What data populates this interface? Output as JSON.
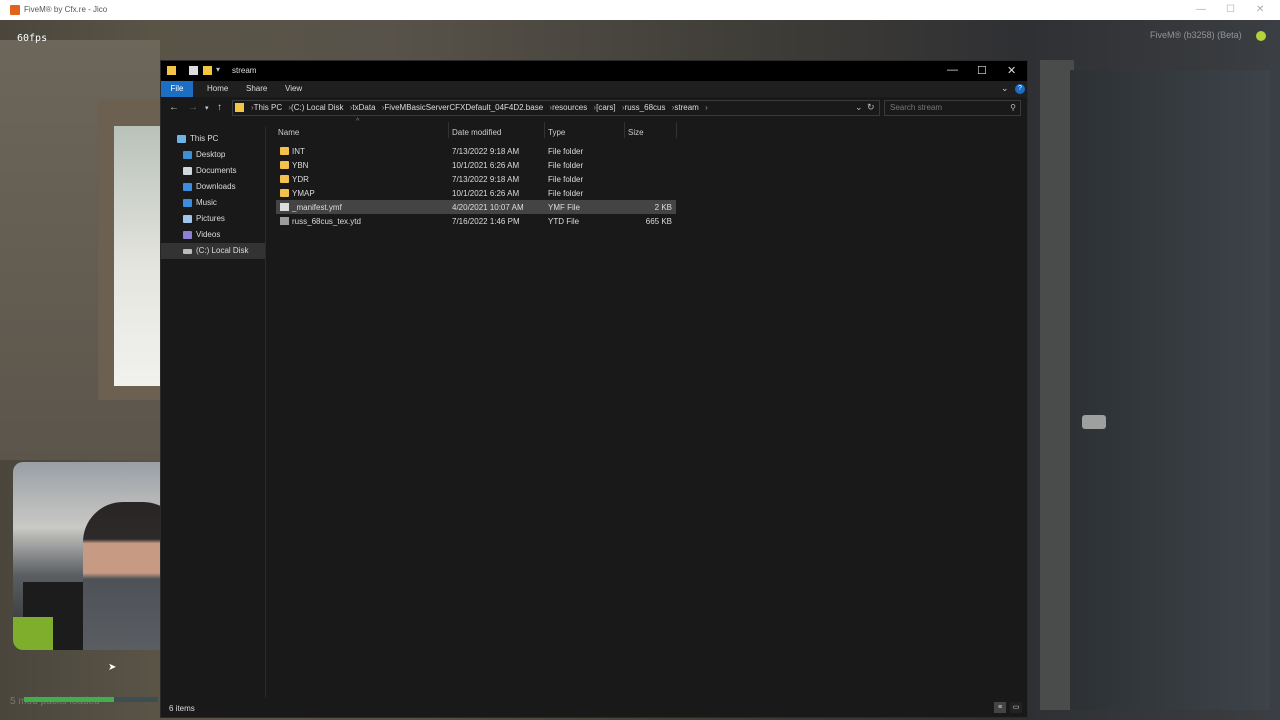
{
  "outer": {
    "title": "FiveM® by Cfx.re - Jico",
    "fps": "60fps",
    "build": "FiveM® (b3258) (Beta)",
    "loaded_text": "5 mod packs loaded",
    "loaded_progress": 0.67
  },
  "explorer": {
    "title": "stream",
    "ribbon": {
      "file": "File",
      "home": "Home",
      "share": "Share",
      "view": "View"
    },
    "breadcrumbs": [
      "This PC",
      "(C:) Local Disk",
      "txData",
      "FiveMBasicServerCFXDefault_04F4D2.base",
      "resources",
      "[cars]",
      "russ_68cus",
      "stream"
    ],
    "search_placeholder": "Search stream",
    "sidebar": [
      {
        "label": "This PC",
        "icon": "pc-icon",
        "color": "#6cb3e6",
        "selected": false
      },
      {
        "label": "Desktop",
        "icon": "desktop-icon",
        "color": "#3d8fd6",
        "selected": false
      },
      {
        "label": "Documents",
        "icon": "documents-icon",
        "color": "#cfd8dc",
        "selected": false
      },
      {
        "label": "Downloads",
        "icon": "downloads-icon",
        "color": "#3c8de0",
        "selected": false
      },
      {
        "label": "Music",
        "icon": "music-icon",
        "color": "#3c8de0",
        "selected": false
      },
      {
        "label": "Pictures",
        "icon": "pictures-icon",
        "color": "#9fc6ea",
        "selected": false
      },
      {
        "label": "Videos",
        "icon": "videos-icon",
        "color": "#8b7fd6",
        "selected": false
      },
      {
        "label": "(C:) Local Disk",
        "icon": "drive-icon",
        "color": "#bbbbbb",
        "selected": true
      }
    ],
    "columns": {
      "name": "Name",
      "date": "Date modified",
      "type": "Type",
      "size": "Size"
    },
    "files": [
      {
        "name": "INT",
        "date": "7/13/2022 9:18 AM",
        "type": "File folder",
        "size": "",
        "kind": "folder",
        "selected": false
      },
      {
        "name": "YBN",
        "date": "10/1/2021 6:26 AM",
        "type": "File folder",
        "size": "",
        "kind": "folder",
        "selected": false
      },
      {
        "name": "YDR",
        "date": "7/13/2022 9:18 AM",
        "type": "File folder",
        "size": "",
        "kind": "folder",
        "selected": false
      },
      {
        "name": "YMAP",
        "date": "10/1/2021 6:26 AM",
        "type": "File folder",
        "size": "",
        "kind": "folder",
        "selected": false
      },
      {
        "name": "_manifest.ymf",
        "date": "4/20/2021 10:07 AM",
        "type": "YMF File",
        "size": "2 KB",
        "kind": "file",
        "selected": true
      },
      {
        "name": "russ_68cus_tex.ytd",
        "date": "7/16/2022 1:46 PM",
        "type": "YTD File",
        "size": "665 KB",
        "kind": "tex",
        "selected": false
      }
    ],
    "status": "6 items"
  }
}
